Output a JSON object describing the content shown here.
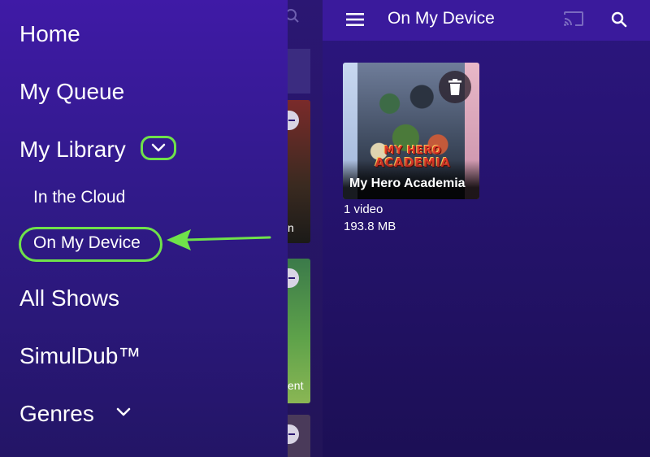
{
  "drawer": {
    "items": [
      {
        "label": "Home"
      },
      {
        "label": "My Queue"
      },
      {
        "label": "My Library"
      },
      {
        "label": "All Shows"
      },
      {
        "label": "SimulDub™"
      },
      {
        "label": "Genres"
      }
    ],
    "library_sub": [
      {
        "label": "In the Cloud"
      },
      {
        "label": "On My Device",
        "highlighted": true
      }
    ]
  },
  "middle": {
    "partial_text_1": "n",
    "partial_text_2": "ent"
  },
  "appbar": {
    "title": "On My Device",
    "icons": [
      "menu-icon",
      "cast-icon",
      "search-icon"
    ]
  },
  "downloads": [
    {
      "title": "My Hero Academia",
      "logo_line1": "MY HERO",
      "logo_line2": "ACADEMIA",
      "count_label": "1 video",
      "size_label": "193.8 MB"
    }
  ],
  "colors": {
    "accent_highlight": "#6fe24a",
    "drawer_bg": "#3f1aa6",
    "appbar_bg": "#3a1a9c"
  }
}
